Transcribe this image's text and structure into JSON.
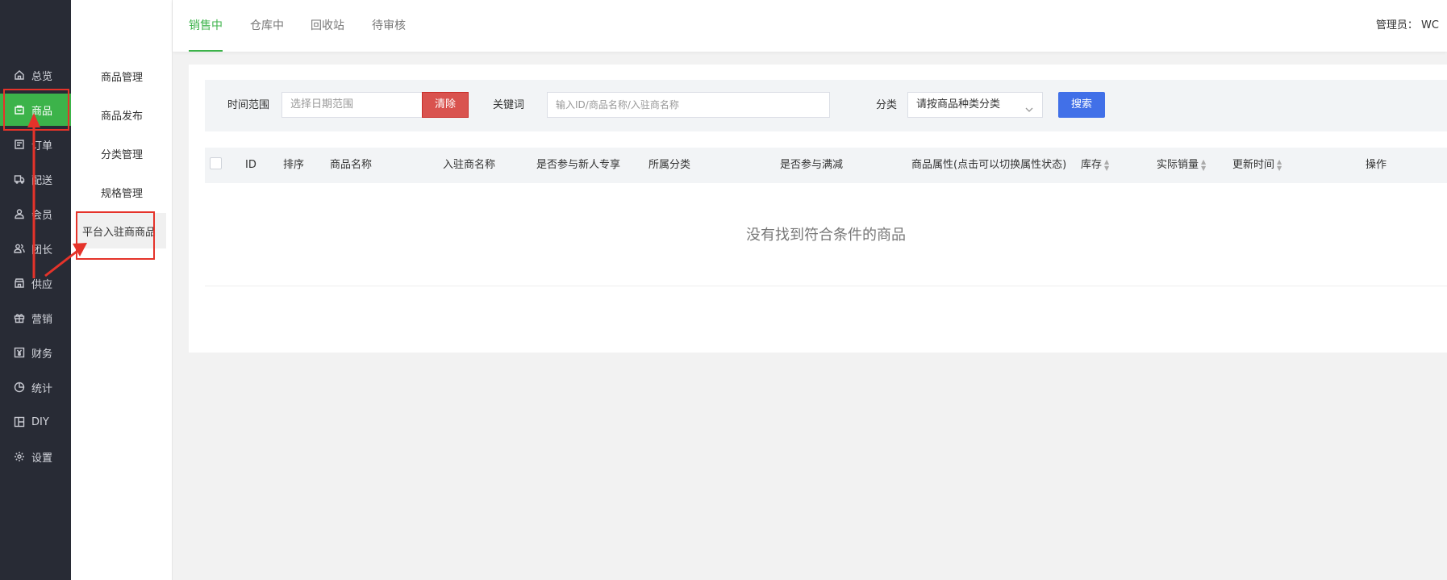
{
  "nav": {
    "items": [
      {
        "label": "总览",
        "icon": "home-icon"
      },
      {
        "label": "商品",
        "icon": "shopping-bag-icon",
        "active": true
      },
      {
        "label": "订单",
        "icon": "order-icon"
      },
      {
        "label": "配送",
        "icon": "delivery-icon"
      },
      {
        "label": "会员",
        "icon": "user-icon"
      },
      {
        "label": "团长",
        "icon": "leader-icon"
      },
      {
        "label": "供应",
        "icon": "store-icon"
      },
      {
        "label": "营销",
        "icon": "gift-icon"
      },
      {
        "label": "财务",
        "icon": "yen-icon"
      },
      {
        "label": "统计",
        "icon": "pie-chart-icon"
      },
      {
        "label": "DIY",
        "icon": "layout-icon"
      },
      {
        "label": "设置",
        "icon": "gear-icon"
      }
    ]
  },
  "subnav": {
    "items": [
      {
        "label": "商品管理"
      },
      {
        "label": "商品发布"
      },
      {
        "label": "分类管理"
      },
      {
        "label": "规格管理"
      },
      {
        "label": "平台入驻商商品",
        "active": true
      }
    ]
  },
  "header": {
    "tabs": [
      {
        "label": "销售中",
        "active": true
      },
      {
        "label": "仓库中"
      },
      {
        "label": "回收站"
      },
      {
        "label": "待审核"
      }
    ],
    "admin": "管理员： WC"
  },
  "filter": {
    "time_label": "时间范围",
    "time_placeholder": "选择日期范围",
    "clear_label": "清除",
    "keyword_label": "关键词",
    "keyword_placeholder": "输入ID/商品名称/入驻商名称",
    "category_label": "分类",
    "category_value": "请按商品种类分类",
    "search_label": "搜索"
  },
  "table": {
    "columns": [
      {
        "label": "ID"
      },
      {
        "label": "排序"
      },
      {
        "label": "商品名称"
      },
      {
        "label": "入驻商名称"
      },
      {
        "label": "是否参与新人专享"
      },
      {
        "label": "所属分类"
      },
      {
        "label": "是否参与满减"
      },
      {
        "label": "商品属性(点击可以切换属性状态)"
      },
      {
        "label": "库存",
        "sortable": true
      },
      {
        "label": "实际销量",
        "sortable": true
      },
      {
        "label": "更新时间",
        "sortable": true
      },
      {
        "label": "操作"
      }
    ],
    "empty_text": "没有找到符合条件的商品"
  },
  "colors": {
    "accent_green": "#3cb34a",
    "danger_red": "#d9534f",
    "primary_blue": "#4170e8",
    "nav_bg": "#282b35",
    "annotation_red": "#e5332a"
  }
}
